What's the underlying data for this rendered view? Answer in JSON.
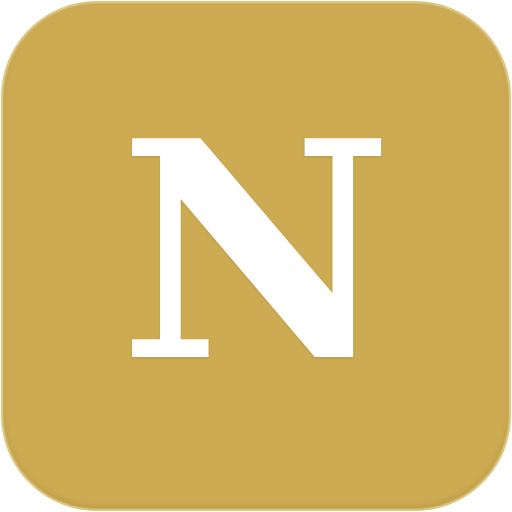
{
  "app": {
    "icon_letter": "N",
    "icon_name": "letter-n-app-icon",
    "background_color": "#ccab52",
    "letter_color": "#ffffff"
  }
}
